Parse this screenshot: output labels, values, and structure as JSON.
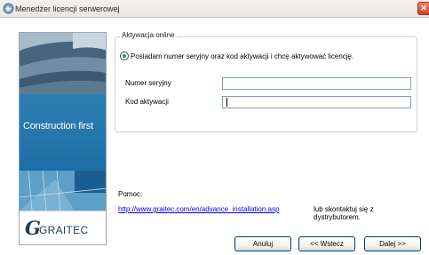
{
  "window": {
    "title": "Menedżer licencji serwerowej",
    "close_glyph": "✕"
  },
  "banner": {
    "slogan": "Construction first",
    "logo_mark": "G",
    "logo_text": "GRAITEC"
  },
  "activation": {
    "group_title": "Aktywacja online",
    "option_label": "Posiadam numer seryjny oraz kod aktywacji i chcę aktywować licencję.",
    "option_selected": true,
    "serial_label": "Numer seryjny",
    "serial_value": "",
    "code_label": "Kod aktywacji",
    "code_value": ""
  },
  "help": {
    "label": "Pomoc:",
    "link_text": "http://www.graitec.com/en/advance_installation.asp",
    "contact_text": "lub skontaktuj się z dystrybutorem."
  },
  "buttons": {
    "cancel": "Anuluj",
    "back": "<< Wstecz",
    "next": "Dalej >>"
  },
  "colors": {
    "banner_blue": "#1d6ea6",
    "logo_navy": "#233a5b",
    "link": "#0000ee",
    "radio_dot": "#21a121",
    "close_red": "#d0432a"
  }
}
